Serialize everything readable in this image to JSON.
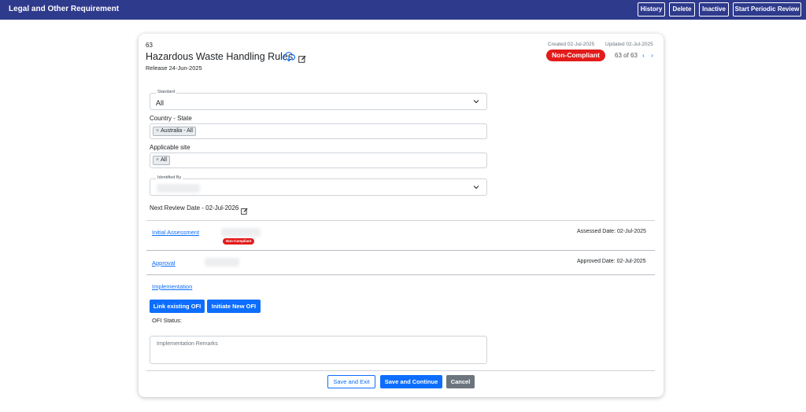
{
  "app": {
    "title": "Legal and Other Requirement"
  },
  "toolbar": {
    "history": "History",
    "delete": "Delete",
    "inactive": "Inactive",
    "start_review": "Start Periodic Review"
  },
  "record": {
    "id": "63",
    "title": "Hazardous Waste Handling Rules",
    "release": "Release 24-Jun-2025",
    "created": "Created 02-Jul-2025",
    "updated": "Updated 02-Jul-2025",
    "status": "Non-Compliant",
    "pager": "63 of 63",
    "prev": "‹",
    "next": "›"
  },
  "form": {
    "standard_label": "Standard",
    "standard_value": "All",
    "country_label": "Country - State",
    "country_chips": [
      "Australia - All"
    ],
    "site_label": "Applicable site",
    "site_chips": [
      "All"
    ],
    "identified_by_label": "Identified By",
    "next_review": "Next Review Date - 02-Jul-2026"
  },
  "workflow": {
    "initial_assessment": "Initial Assessment",
    "initial_badge": "Non-Compliant",
    "assessed_date": "Assessed Date: 02-Jul-2025",
    "approval": "Approval",
    "approved_date": "Approved Date: 02-Jul-2025",
    "implementation": "Implementation",
    "link_ofi": "Link existing OFI",
    "new_ofi": "Initiate New OFI",
    "ofi_status": "OFI Status:",
    "remarks_placeholder": "Implementation Remarks"
  },
  "footer": {
    "save_exit": "Save and Exit",
    "save_continue": "Save and Continue",
    "cancel": "Cancel"
  },
  "colors": {
    "header_bg": "#2e3a8c",
    "primary": "#0d6efd",
    "danger": "#e31b1b",
    "secondary": "#6c757d"
  }
}
